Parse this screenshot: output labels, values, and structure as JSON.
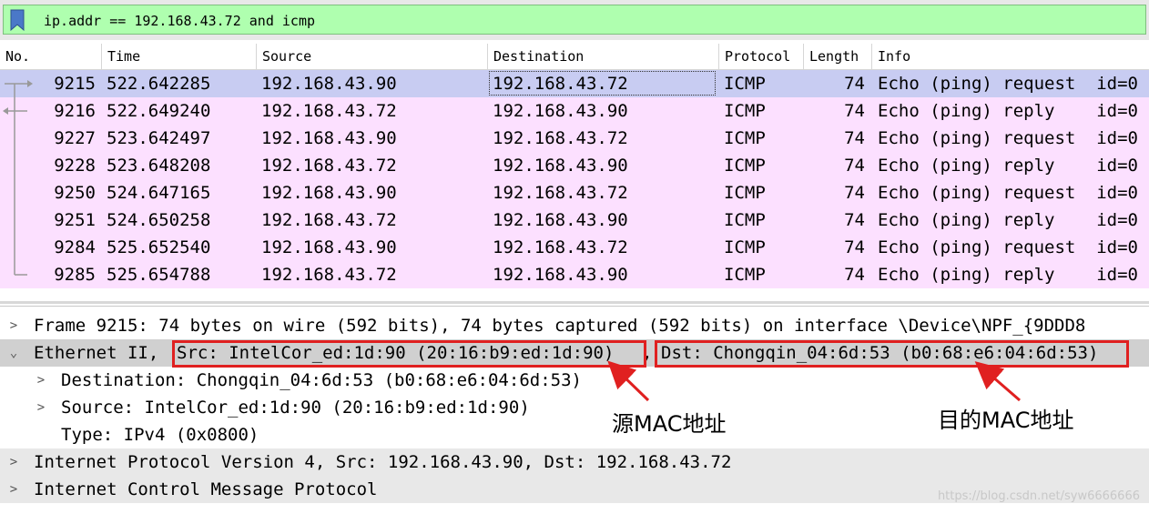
{
  "filter": {
    "value": "ip.addr == 192.168.43.72 and icmp"
  },
  "columns": [
    "No.",
    "Time",
    "Source",
    "Destination",
    "Protocol",
    "Length",
    "Info"
  ],
  "packets": [
    {
      "no": "9215",
      "time": "522.642285",
      "src": "192.168.43.90",
      "dst": "192.168.43.72",
      "proto": "ICMP",
      "len": "74",
      "info": "Echo (ping) request  id=0"
    },
    {
      "no": "9216",
      "time": "522.649240",
      "src": "192.168.43.72",
      "dst": "192.168.43.90",
      "proto": "ICMP",
      "len": "74",
      "info": "Echo (ping) reply    id=0"
    },
    {
      "no": "9227",
      "time": "523.642497",
      "src": "192.168.43.90",
      "dst": "192.168.43.72",
      "proto": "ICMP",
      "len": "74",
      "info": "Echo (ping) request  id=0"
    },
    {
      "no": "9228",
      "time": "523.648208",
      "src": "192.168.43.72",
      "dst": "192.168.43.90",
      "proto": "ICMP",
      "len": "74",
      "info": "Echo (ping) reply    id=0"
    },
    {
      "no": "9250",
      "time": "524.647165",
      "src": "192.168.43.90",
      "dst": "192.168.43.72",
      "proto": "ICMP",
      "len": "74",
      "info": "Echo (ping) request  id=0"
    },
    {
      "no": "9251",
      "time": "524.650258",
      "src": "192.168.43.72",
      "dst": "192.168.43.90",
      "proto": "ICMP",
      "len": "74",
      "info": "Echo (ping) reply    id=0"
    },
    {
      "no": "9284",
      "time": "525.652540",
      "src": "192.168.43.90",
      "dst": "192.168.43.72",
      "proto": "ICMP",
      "len": "74",
      "info": "Echo (ping) request  id=0"
    },
    {
      "no": "9285",
      "time": "525.654788",
      "src": "192.168.43.72",
      "dst": "192.168.43.90",
      "proto": "ICMP",
      "len": "74",
      "info": "Echo (ping) reply    id=0"
    }
  ],
  "details": {
    "frame": "Frame 9215: 74 bytes on wire (592 bits), 74 bytes captured (592 bits) on interface \\Device\\NPF_{9DDD8",
    "ethernet_prefix": "Ethernet II, ",
    "ethernet_src": "Src: IntelCor_ed:1d:90 (20:16:b9:ed:1d:90)",
    "ethernet_sep": ", ",
    "ethernet_dst": "Dst: Chongqin_04:6d:53 (b0:68:e6:04:6d:53)",
    "eth_destination": "Destination: Chongqin_04:6d:53 (b0:68:e6:04:6d:53)",
    "eth_source": "Source: IntelCor_ed:1d:90 (20:16:b9:ed:1d:90)",
    "eth_type": "Type: IPv4 (0x0800)",
    "ip": "Internet Protocol Version 4, Src: 192.168.43.90, Dst: 192.168.43.72",
    "icmp": "Internet Control Message Protocol"
  },
  "annotations": {
    "src_mac": "源MAC地址",
    "dst_mac": "目的MAC地址"
  },
  "watermark": "https://blog.csdn.net/syw6666666",
  "colors": {
    "filter_bg": "#afffaf",
    "row_bg": "#fce0ff",
    "selected_bg": "#c8ccf2",
    "annotation_red": "#e02020"
  }
}
